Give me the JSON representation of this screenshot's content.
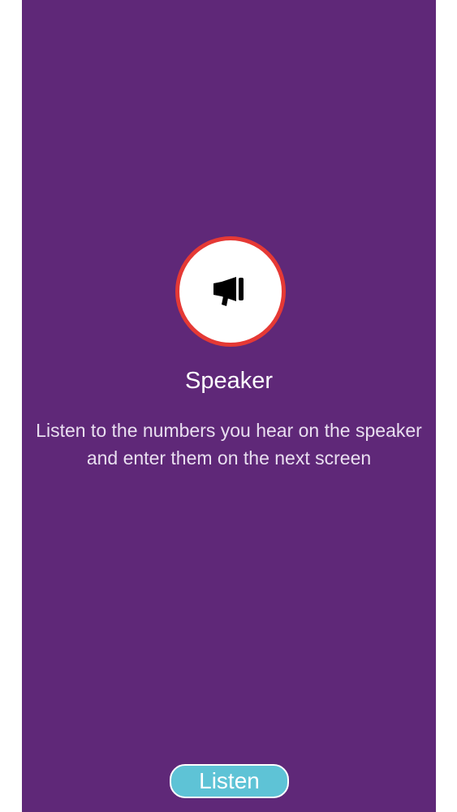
{
  "colors": {
    "background": "#5f2878",
    "icon_ring": "#e53935",
    "button_fill": "#5ec3d6",
    "text": "#ffffff"
  },
  "icon": "megaphone-icon",
  "title": "Speaker",
  "description": "Listen to the numbers you hear on the speaker and enter them on the next screen",
  "button": {
    "label": "Listen"
  }
}
